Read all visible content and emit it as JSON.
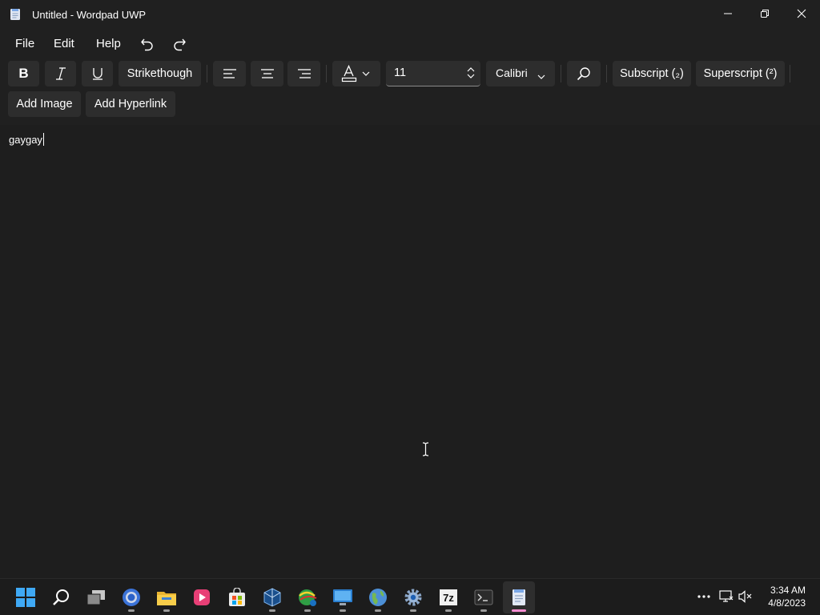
{
  "window": {
    "title": "Untitled - Wordpad UWP"
  },
  "menu": {
    "file": "File",
    "edit": "Edit",
    "help": "Help"
  },
  "toolbar": {
    "bold_label": "B",
    "strikethrough_label": "Strikethough",
    "font_size": "11",
    "font_family": "Calibri",
    "subscript_label": "Subscript (₂)",
    "superscript_label": "Superscript (²)",
    "add_image_label": "Add Image",
    "add_hyperlink_label": "Add Hyperlink"
  },
  "document": {
    "text": "gaygay"
  },
  "taskbar": {
    "apps": [
      {
        "name": "start",
        "icon": "windows-logo-icon"
      },
      {
        "name": "search",
        "icon": "search-icon"
      },
      {
        "name": "task-view",
        "icon": "task-view-icon"
      },
      {
        "name": "chrome",
        "icon": "chrome-icon",
        "running": true
      },
      {
        "name": "file-explorer",
        "icon": "folder-icon",
        "running": true
      },
      {
        "name": "media-player",
        "icon": "media-player-icon"
      },
      {
        "name": "store",
        "icon": "store-icon"
      },
      {
        "name": "virtualbox",
        "icon": "virtualbox-icon",
        "running": true
      },
      {
        "name": "network-app",
        "icon": "network-globe-icon",
        "running": true
      },
      {
        "name": "remote-desktop",
        "icon": "remote-desktop-icon",
        "running": true
      },
      {
        "name": "browser-globe",
        "icon": "globe-icon",
        "running": true
      },
      {
        "name": "settings",
        "icon": "settings-gear-icon",
        "running": true
      },
      {
        "name": "7zip",
        "icon": "7zip-icon",
        "label": "7z",
        "running": true
      },
      {
        "name": "terminal",
        "icon": "terminal-icon",
        "running": true
      },
      {
        "name": "wordpad",
        "icon": "wordpad-icon",
        "running": true,
        "active": true
      }
    ],
    "clock_time": "3:34 AM",
    "clock_date": "4/8/2023"
  },
  "colors": {
    "accent_indicator": "#ff8dd2",
    "background": "#202020",
    "button": "#2d2d2d"
  }
}
